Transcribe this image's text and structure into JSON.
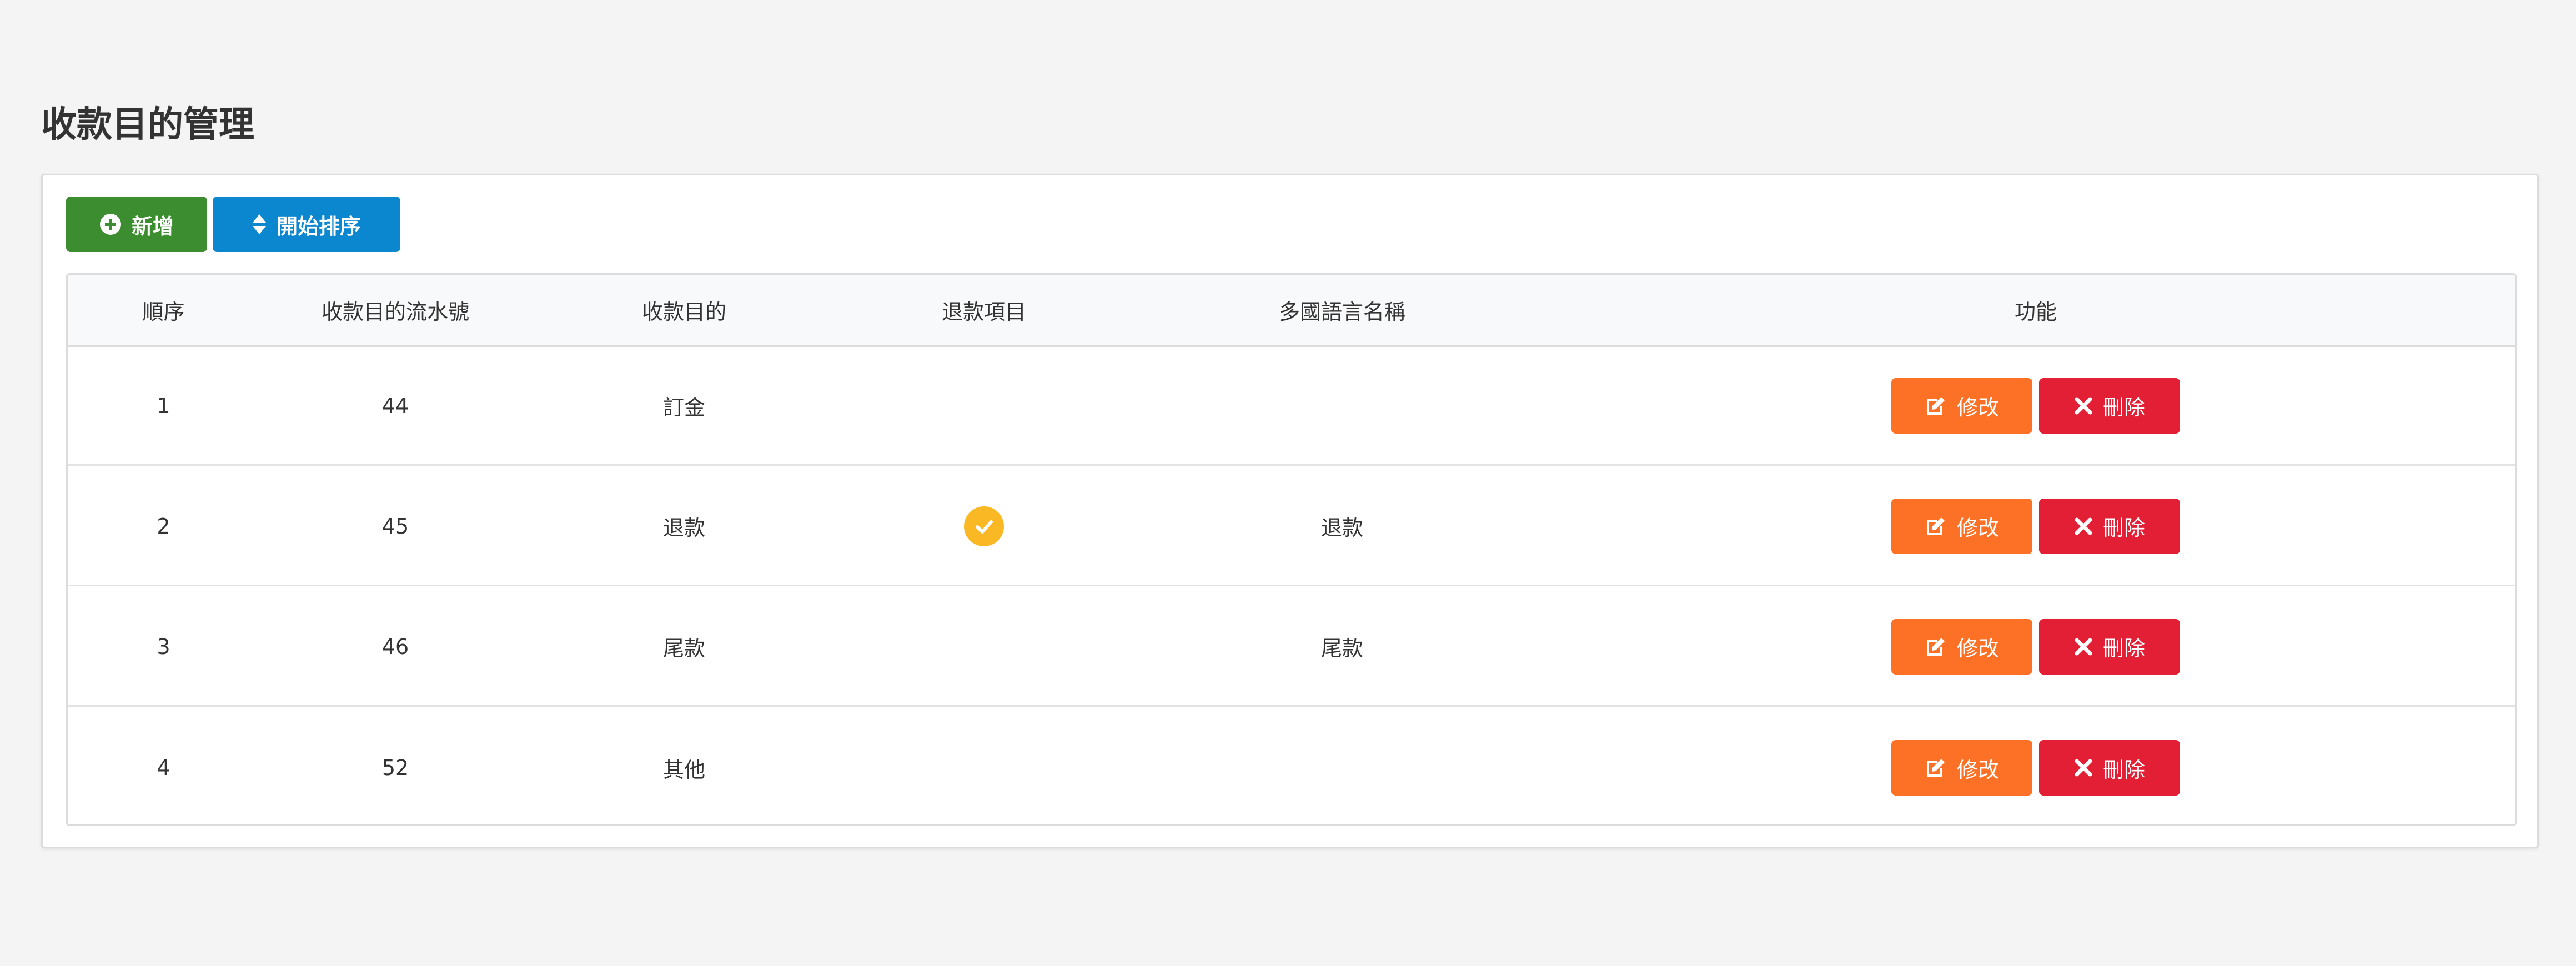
{
  "page": {
    "title": "收款目的管理"
  },
  "toolbar": {
    "add_label": "新增",
    "sort_label": "開始排序"
  },
  "table": {
    "headers": [
      "順序",
      "收款目的流水號",
      "收款目的",
      "退款項目",
      "多國語言名稱",
      "功能"
    ],
    "rows": [
      {
        "order": "1",
        "serial": "44",
        "purpose": "訂金",
        "refund": false,
        "i18n_name": ""
      },
      {
        "order": "2",
        "serial": "45",
        "purpose": "退款",
        "refund": true,
        "i18n_name": "退款"
      },
      {
        "order": "3",
        "serial": "46",
        "purpose": "尾款",
        "refund": false,
        "i18n_name": "尾款"
      },
      {
        "order": "4",
        "serial": "52",
        "purpose": "其他",
        "refund": false,
        "i18n_name": ""
      }
    ],
    "actions": {
      "edit_label": "修改",
      "delete_label": "刪除"
    }
  },
  "colors": {
    "add": "#3c8d2f",
    "sort": "#0b87cf",
    "edit": "#fc7125",
    "delete": "#e21f34",
    "check": "#f9b824"
  },
  "icons": {
    "add": "plus-circle-icon",
    "sort": "sort-icon",
    "edit": "edit-icon",
    "delete": "times-icon",
    "refund": "check-circle-icon"
  }
}
